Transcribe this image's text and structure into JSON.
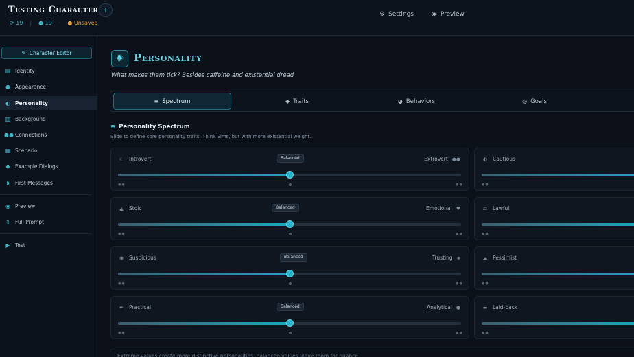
{
  "header": {
    "title": "Testing Character",
    "add_label": "+",
    "stat_sync": "19",
    "stat_tokens": "19",
    "separator": "·",
    "unsaved": "Unsaved",
    "nav": [
      {
        "label": "Settings",
        "icon": "gear-icon"
      },
      {
        "label": "Preview",
        "icon": "eye-icon"
      }
    ]
  },
  "sidebar": {
    "editor_button": "Character Editor",
    "items": [
      {
        "label": "Identity",
        "icon": "id-card-icon"
      },
      {
        "label": "Appearance",
        "icon": "person-icon"
      },
      {
        "label": "Personality",
        "icon": "brain-icon",
        "active": true
      },
      {
        "label": "Background",
        "icon": "book-icon"
      },
      {
        "label": "Connections",
        "icon": "people-icon"
      },
      {
        "label": "Scenario",
        "icon": "map-icon"
      },
      {
        "label": "Example Dialogs",
        "icon": "chat-icon"
      },
      {
        "label": "First Messages",
        "icon": "message-icon"
      }
    ],
    "items2": [
      {
        "label": "Preview",
        "icon": "eye-icon"
      },
      {
        "label": "Full Prompt",
        "icon": "document-icon"
      }
    ],
    "items3": [
      {
        "label": "Test",
        "icon": "play-icon"
      }
    ]
  },
  "section": {
    "title": "Personality",
    "subtitle": "What makes them tick? Besides caffeine and existential dread"
  },
  "tabs": [
    {
      "label": "Spectrum",
      "icon": "sliders-icon",
      "active": true
    },
    {
      "label": "Traits",
      "icon": "tag-icon"
    },
    {
      "label": "Behaviors",
      "icon": "masks-icon"
    },
    {
      "label": "Goals",
      "icon": "target-icon"
    }
  ],
  "spectrum": {
    "title": "Personality Spectrum",
    "subtitle": "Slide to define core personality traits. Think Sims, but with more existential weight.",
    "sliders": [
      {
        "left": "Introvert",
        "right": "Extrovert",
        "badge": "Balanced",
        "value": 0.5
      },
      {
        "left": "Stoic",
        "right": "Emotional",
        "badge": "Balanced",
        "value": 0.5
      },
      {
        "left": "Suspicious",
        "right": "Trusting",
        "badge": "Balanced",
        "value": 0.5
      },
      {
        "left": "Practical",
        "right": "Analytical",
        "badge": "Balanced",
        "value": 0.5
      }
    ],
    "sliders_right": [
      {
        "left": "Cautious"
      },
      {
        "left": "Lawful"
      },
      {
        "left": "Pessimist"
      },
      {
        "left": "Laid-back"
      }
    ]
  },
  "footnote": "Extreme values create more distinctive personalities, balanced values leave room for nuance."
}
